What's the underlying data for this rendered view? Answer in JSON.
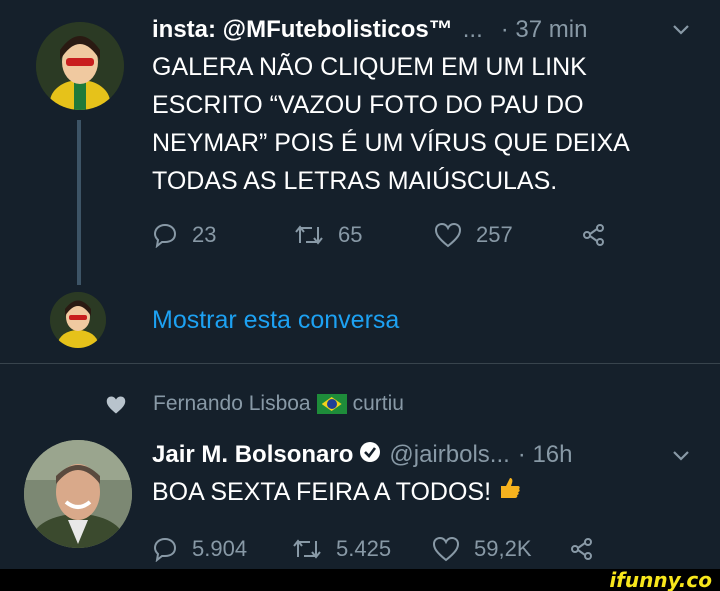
{
  "tweet1": {
    "display_name": "insta: @MFutebolisticos™",
    "ellipsis": "...",
    "time": "· 37 min",
    "text": "GALERA NÃO CLIQUEM EM UM LINK\nESCRITO “VAZOU FOTO DO PAU DO\nNEYMAR” POIS É UM VÍRUS QUE DEIXA\nTODAS AS LETRAS MAIÚSCULAS.",
    "replies": "23",
    "retweets": "65",
    "likes": "257"
  },
  "show_conversation": "Mostrar esta conversa",
  "liked_by": {
    "name": "Fernando Lisboa",
    "action": "curtiu"
  },
  "tweet2": {
    "display_name": "Jair M. Bolsonaro",
    "handle": "@jairbols...",
    "time": "· 16h",
    "text": "BOA SEXTA FEIRA A TODOS!",
    "replies": "5.904",
    "retweets": "5.425",
    "likes": "59,2K"
  },
  "watermark": "ifunny.co",
  "colors": {
    "background": "#15202b",
    "muted": "#8899a6",
    "link": "#1da1f2",
    "divider": "#38444d"
  },
  "icons": [
    "reply-icon",
    "retweet-icon",
    "like-icon",
    "share-icon",
    "chevron-down-icon",
    "verified-icon",
    "heart-filled-icon",
    "brazil-flag-icon",
    "thumbs-up-icon"
  ]
}
